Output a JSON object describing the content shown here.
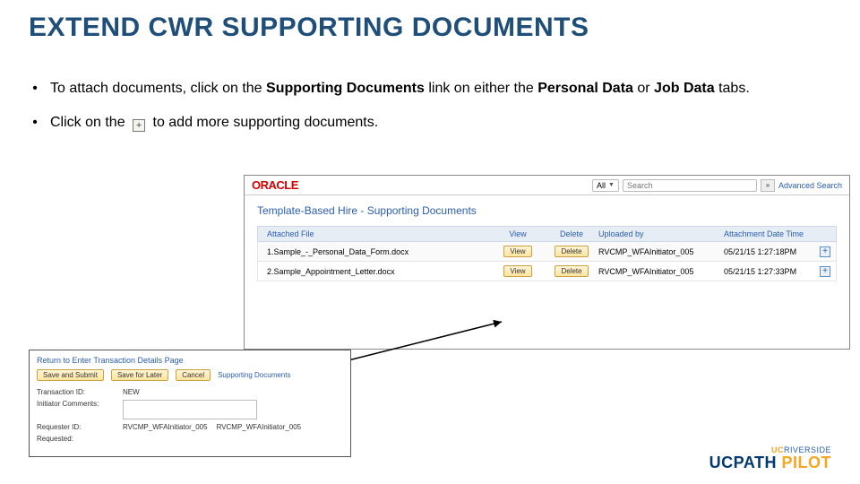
{
  "title": "EXTEND CWR SUPPORTING DOCUMENTS",
  "bullets": {
    "b1_pre": "To attach documents, click on the ",
    "b1_bold1": "Supporting Documents",
    "b1_mid1": " link on either the ",
    "b1_bold2": "Personal Data",
    "b1_mid2": " or ",
    "b1_bold3": "Job Data",
    "b1_post": " tabs.",
    "b2_pre": "Click on the ",
    "b2_post": " to add more supporting documents."
  },
  "main": {
    "oracle_logo": "ORACLE",
    "dd_label": "All",
    "search_placeholder": "Search",
    "go": "»",
    "adv": "Advanced Search",
    "page_title": "Template-Based Hire - Supporting Documents",
    "headers": {
      "file": "Attached File",
      "view": "View",
      "delete": "Delete",
      "upl": "Uploaded by",
      "dt": "Attachment Date Time"
    },
    "rows": [
      {
        "num": "1",
        "file": "Sample_-_Personal_Data_Form.docx",
        "view": "View",
        "del": "Delete",
        "upl": "RVCMP_WFAInitiator_005",
        "dt": "05/21/15  1:27:18PM"
      },
      {
        "num": "2",
        "file": "Sample_Appointment_Letter.docx",
        "view": "View",
        "del": "Delete",
        "upl": "RVCMP_WFAInitiator_005",
        "dt": "05/21/15  1:27:33PM"
      }
    ]
  },
  "sec": {
    "return_link": "Return to Enter Transaction Details Page",
    "save_submit": "Save and Submit",
    "save_later": "Save for Later",
    "cancel": "Cancel",
    "supporting": "Supporting Documents",
    "tid_label": "Transaction ID:",
    "tid_value": "NEW",
    "comments_label": "Initiator Comments:",
    "requester_label": "Requester ID:",
    "req1": "RVCMP_WFAInitiator_005",
    "req2": "RVCMP_WFAInitiator_005",
    "requested_label": "Requested:"
  },
  "footer": {
    "uc": "UC",
    "riverside": "RIVERSIDE",
    "ucpath": "UCPATH",
    "pilot": " PILOT"
  }
}
